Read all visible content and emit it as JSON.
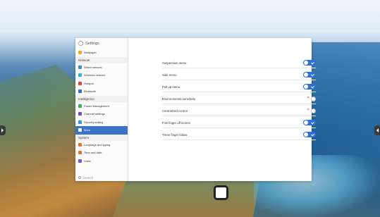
{
  "window": {
    "title": "Settings"
  },
  "sidebar": {
    "groups": [
      {
        "label": "",
        "items": [
          {
            "label": "Wallpaper",
            "icon": "wallpaper-icon",
            "color": "#f2b01e"
          }
        ]
      },
      {
        "label": "Network",
        "items": [
          {
            "label": "Wired network",
            "icon": "wired-network-icon",
            "color": "#3a8fd8"
          },
          {
            "label": "Wireless network",
            "icon": "wifi-icon",
            "color": "#2bb5c9"
          },
          {
            "label": "Hotspot",
            "icon": "hotspot-icon",
            "color": "#e0453b"
          },
          {
            "label": "Bluetooth",
            "icon": "bluetooth-icon",
            "color": "#2f6fd6"
          }
        ]
      },
      {
        "label": "Intelligence",
        "items": [
          {
            "label": "Power Management",
            "icon": "power-icon",
            "color": "#3fb24a"
          },
          {
            "label": "Channel settings",
            "icon": "channel-icon",
            "color": "#6a4fc8"
          },
          {
            "label": "Security setting",
            "icon": "security-icon",
            "color": "#2f9ad6"
          },
          {
            "label": "More",
            "icon": "more-icon",
            "color": "#3a73c7",
            "active": true
          }
        ]
      },
      {
        "label": "System",
        "items": [
          {
            "label": "Language and typing",
            "icon": "language-icon",
            "color": "#e8742c"
          },
          {
            "label": "Time and date",
            "icon": "clock-icon",
            "color": "#e8742c"
          },
          {
            "label": "Voice",
            "icon": "voice-icon",
            "color": "#7b52c9"
          }
        ]
      }
    ],
    "search_placeholder": "Search"
  },
  "settings": [
    {
      "label": "Suspension menu",
      "state": "on"
    },
    {
      "label": "Side menu",
      "state": "on"
    },
    {
      "label": "Pull up menu",
      "state": "on"
    },
    {
      "label": "Environmental sensitivity",
      "state": "off"
    },
    {
      "label": "Centralized control",
      "state": "off"
    },
    {
      "label": "Five finger off screen",
      "state": "on"
    },
    {
      "label": "Three finger follow",
      "state": "on"
    }
  ],
  "colors": {
    "accent": "#2f6fd6",
    "active_item": "#3a73c7",
    "off_mark": "#e34848"
  }
}
